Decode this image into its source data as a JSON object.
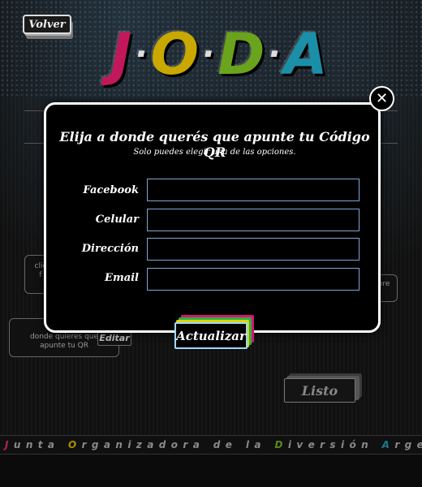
{
  "header": {
    "back_label": "Volver",
    "logo": {
      "letters": [
        "J",
        "O",
        "D",
        "A"
      ]
    }
  },
  "background": {
    "left_card_partial": "clic\nf",
    "left_card_text": "clic\ndonde quieres que\napunte tu QR",
    "edit_label": "Editar",
    "right_card_partial": "bre",
    "done_label": "Listo"
  },
  "modal": {
    "title": "Elija a donde querés  que apunte tu Código QR",
    "subtitle": "Solo puedes elegir una de las opciones.",
    "fields": [
      {
        "label": "Facebook",
        "value": ""
      },
      {
        "label": "Celular",
        "value": ""
      },
      {
        "label": "Dirección",
        "value": ""
      },
      {
        "label": "Email",
        "value": ""
      }
    ],
    "submit_label": "Actualizar",
    "close_label": "✕"
  },
  "footer": {
    "words": [
      {
        "cap": "J",
        "rest": "unta"
      },
      {
        "cap": "O",
        "rest": "rganizadora de la"
      },
      {
        "cap": "D",
        "rest": "iversión"
      },
      {
        "cap": "A",
        "rest": "rgentina"
      }
    ]
  },
  "colors": {
    "j": "#c2185b",
    "o": "#c9a800",
    "d": "#6aa31c",
    "a": "#1b8fa8",
    "input_border": "#7fa6d6"
  }
}
